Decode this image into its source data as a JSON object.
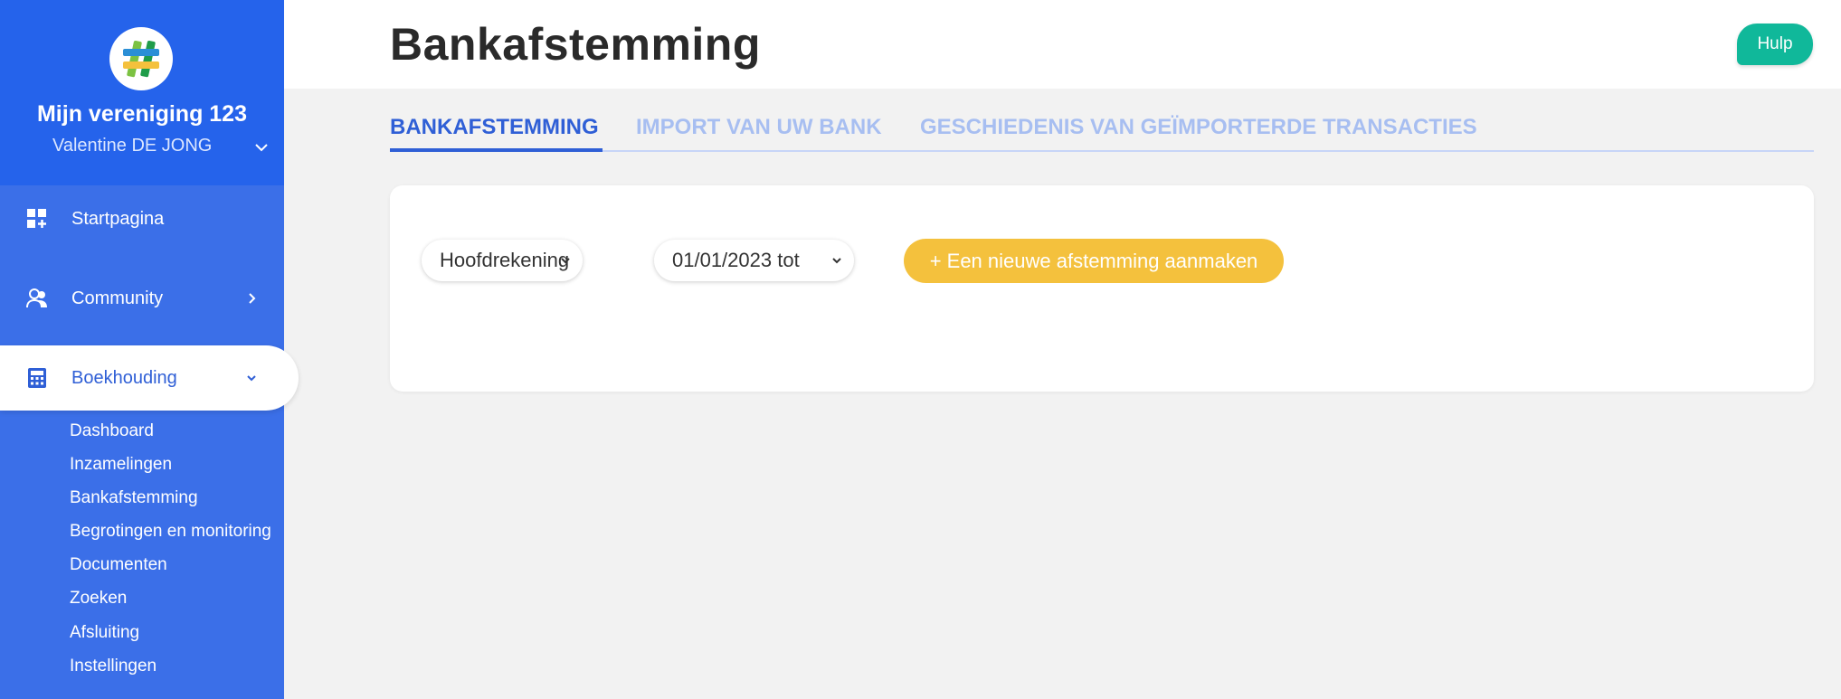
{
  "sidebar": {
    "org_name": "Mijn vereniging 123",
    "user_name": "Valentine DE JONG",
    "nav": [
      {
        "label": "Startpagina",
        "icon": "dashboard-plus-icon"
      },
      {
        "label": "Community",
        "icon": "users-icon"
      },
      {
        "label": "Boekhouding",
        "icon": "calculator-icon"
      }
    ],
    "sub_items": [
      {
        "label": "Dashboard"
      },
      {
        "label": "Inzamelingen"
      },
      {
        "label": "Bankafstemming"
      },
      {
        "label": "Begrotingen en monitoring"
      },
      {
        "label": "Documenten"
      },
      {
        "label": "Zoeken"
      },
      {
        "label": "Afsluiting"
      },
      {
        "label": "Instellingen"
      }
    ]
  },
  "header": {
    "title": "Bankafstemming",
    "help_label": "Hulp"
  },
  "tabs": [
    {
      "label": "BANKAFSTEMMING",
      "active": true
    },
    {
      "label": "IMPORT VAN UW BANK",
      "active": false
    },
    {
      "label": "GESCHIEDENIS VAN GEÏMPORTERDE TRANSACTIES",
      "active": false
    }
  ],
  "filters": {
    "account_value": "Hoofdrekening",
    "period_value": "01/01/2023 tot"
  },
  "actions": {
    "new_reconciliation_label": "+ Een nieuwe afstemming aanmaken"
  },
  "colors": {
    "sidebar": "#3b6fe8",
    "sidebar_header": "#2563eb",
    "accent_blue": "#2f5fd6",
    "help_green": "#10b89a",
    "button_yellow": "#f4c13d"
  }
}
